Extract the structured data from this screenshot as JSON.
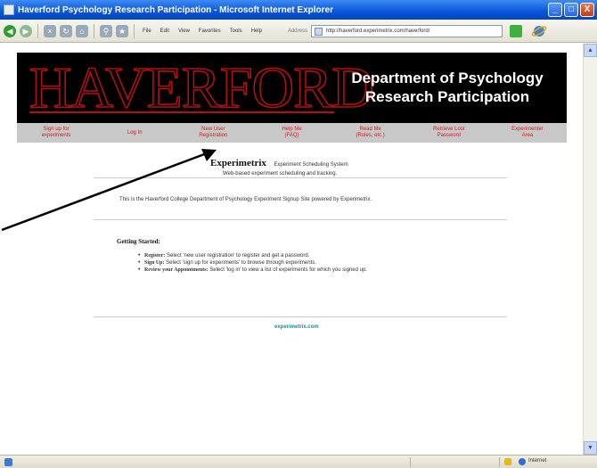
{
  "window": {
    "title": "Haverford Psychology Research Participation - Microsoft Internet Explorer",
    "controls": [
      "_",
      "□",
      "X"
    ]
  },
  "toolbar": {
    "menu": [
      "File",
      "Edit",
      "View",
      "Favorites",
      "Tools",
      "Help"
    ],
    "address_label": "Address",
    "address_value": "http://haverford.experimetrix.com/haverford/"
  },
  "banner": {
    "logo": "HAVERFORD",
    "dept_line1": "Department of Psychology",
    "dept_line2": "Research Participation"
  },
  "nav": {
    "items": [
      "Sign up for\nexperiments",
      "Log In",
      "New User\nRegistration",
      "Help Me\n(FAQ)",
      "Read Me\n(Rules, etc.)",
      "Retrieve Lost\nPassword",
      "Experimenter\nArea"
    ]
  },
  "content": {
    "product_name": "Experimetrix",
    "product_tagline": "Experiment Scheduling System",
    "product_sub": "Web-based experiment scheduling and tracking.",
    "intro": "This is the Haverford College Department of Psychology Experiment Signup Site powered by Experimetrix.",
    "getting_started_title": "Getting Started:",
    "steps": [
      {
        "label": "Register:",
        "text": " Select 'new user registration' to register and get a password."
      },
      {
        "label": "Sign Up:",
        "text": " Select 'sign up for experiments' to browse through experiments."
      },
      {
        "label": "Review your Appointments:",
        "text": " Select 'log in' to view a list of experiments for which you signed up."
      }
    ],
    "footer_link": "experimetrix.com"
  },
  "statusbar": {
    "zone": "Internet"
  }
}
